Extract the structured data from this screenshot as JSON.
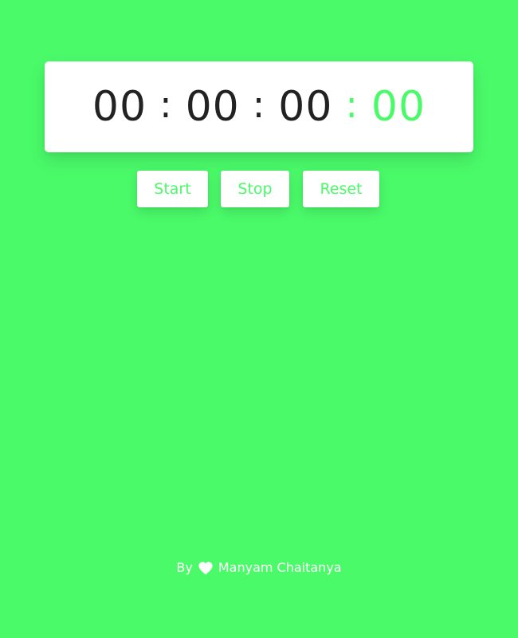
{
  "timer": {
    "hours": "00",
    "minutes": "00",
    "seconds": "00",
    "milliseconds": "00",
    "separator": ":"
  },
  "controls": {
    "start_label": "Start",
    "stop_label": "Stop",
    "reset_label": "Reset"
  },
  "footer": {
    "prefix": "By",
    "icon": "heart-icon",
    "author": "Manyam Chaitanya"
  },
  "colors": {
    "background": "#4afa69",
    "accent": "#4afa69",
    "digits": "#222222",
    "card": "#ffffff"
  }
}
